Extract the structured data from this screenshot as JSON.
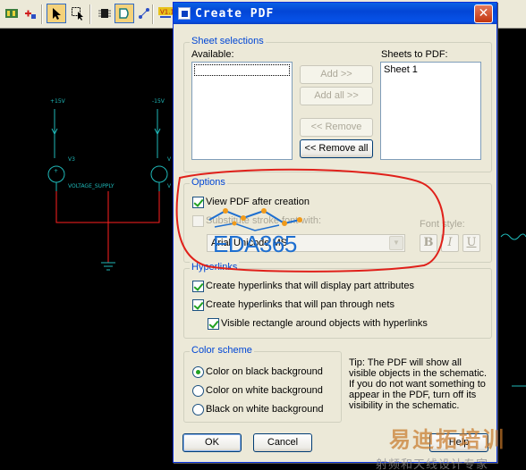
{
  "background": {
    "toolbar": {
      "icons": [
        "schematic-icon",
        "add-part-icon",
        "select-arrow-icon",
        "select-area-icon",
        "chip-icon",
        "logic-gate-icon",
        "probe-icon",
        "wire-icon",
        "voltage-marker-icon"
      ]
    },
    "schematic": {
      "net_left": "+15V",
      "net_right": "-15V",
      "source_left_ref": "V3",
      "source_right_ref": "V",
      "source_left_value": "VOLTAGE_SUPPLY",
      "source_right_value": "V",
      "wire_color": "#ff2020",
      "net_color": "#1fb8b8"
    }
  },
  "dialog": {
    "title": "Create PDF",
    "close_label": "✕",
    "sheet_selections": {
      "title": "Sheet selections",
      "available_label": "Available:",
      "available_items": [],
      "sheets_label": "Sheets to PDF:",
      "sheets_items": [
        "Sheet 1"
      ],
      "add_label": "Add >>",
      "add_all_label": "Add all >>",
      "remove_label": "<< Remove",
      "remove_all_label": "<< Remove all"
    },
    "options": {
      "title": "Options",
      "view_pdf_label": "View PDF after creation",
      "view_pdf_checked": true,
      "substitute_label": "Substitute stroke font with:",
      "substitute_checked": false,
      "font_value": "Arial Unicode MS",
      "font_style_label": "Font style:",
      "bold_label": "B",
      "italic_label": "I",
      "underline_label": "U"
    },
    "hyperlinks": {
      "title": "Hyperlinks",
      "items": [
        {
          "label": "Create hyperlinks that will display part attributes",
          "checked": true
        },
        {
          "label": "Create hyperlinks that will pan through nets",
          "checked": true
        },
        {
          "label": "Visible rectangle around objects with hyperlinks",
          "checked": true
        }
      ]
    },
    "color_scheme": {
      "title": "Color scheme",
      "options": [
        {
          "label": "Color on black background",
          "selected": true
        },
        {
          "label": "Color on white background",
          "selected": false
        },
        {
          "label": "Black on white background",
          "selected": false
        }
      ]
    },
    "tip": "Tip: The PDF will show all\nvisible objects in the schematic.\nIf you do not want something to\nappear in the PDF, turn off its\nvisibility in the schematic.",
    "ok_label": "OK",
    "cancel_label": "Cancel",
    "help_label": "Help"
  },
  "overlay": {
    "annotation_color": "#e0201a",
    "logo_text": "EDA365",
    "watermark_top": "易迪拓培训",
    "watermark_bottom": "射频和天线设计专家"
  }
}
